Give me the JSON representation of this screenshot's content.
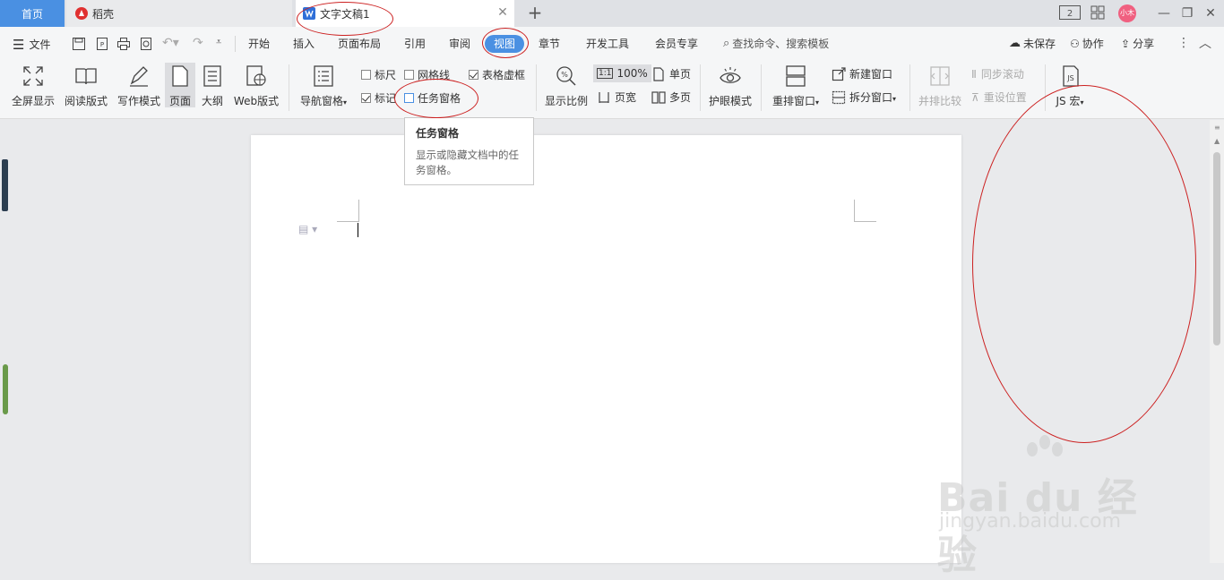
{
  "tabs": {
    "home": "首页",
    "daoke": "稻壳",
    "doc": "文字文稿1"
  },
  "window": {
    "avatar_text": "小木",
    "unsaved": "未保存",
    "collab": "协作",
    "share": "分享"
  },
  "menu": {
    "file": "文件",
    "start": "开始",
    "insert": "插入",
    "layout": "页面布局",
    "reference": "引用",
    "review": "审阅",
    "view": "视图",
    "chapter": "章节",
    "devtools": "开发工具",
    "member": "会员专享",
    "search_placeholder": "查找命令、搜索模板"
  },
  "ribbon": {
    "fullscreen": "全屏显示",
    "reading": "阅读版式",
    "writing": "写作模式",
    "page": "页面",
    "outline": "大纲",
    "web": "Web版式",
    "nav_pane": "导航窗格",
    "ruler": "标尺",
    "gridlines": "网格线",
    "table_gridlines": "表格虚框",
    "marks": "标记",
    "task_pane": "任务窗格",
    "zoom": "显示比例",
    "zoom_percent_icon": "1:1",
    "zoom_100": "100%",
    "page_width": "页宽",
    "single_page": "单页",
    "multi_page": "多页",
    "eye_mode": "护眼模式",
    "rearrange": "重排窗口",
    "new_window": "新建窗口",
    "split_window": "拆分窗口",
    "side_by_side": "并排比较",
    "sync_scroll": "同步滚动",
    "reset_position": "重设位置",
    "js_macro": "JS 宏"
  },
  "tooltip": {
    "title": "任务窗格",
    "desc": "显示或隐藏文档中的任务窗格。"
  },
  "watermark": {
    "main": "Bai du 经验",
    "sub": "jingyan.baidu.com"
  },
  "colors": {
    "accent": "#4a90e2",
    "annotation": "#cc2020"
  }
}
